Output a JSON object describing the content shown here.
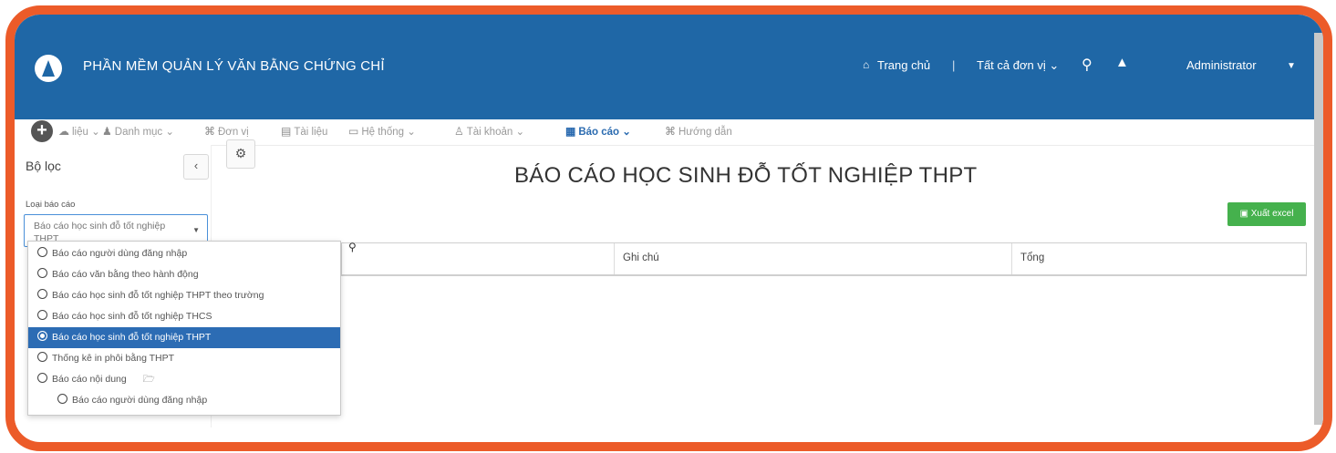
{
  "header": {
    "app_title": "PHẦN MỀM QUẢN LÝ VĂN BẰNG CHỨNG CHỈ",
    "home_label": "Trang chủ",
    "separator": "|",
    "unit_select": "Tất cả đơn vị ⌄",
    "user": "Administrator",
    "colors": {
      "bar": "#1f67a6",
      "frame": "#ec5b29"
    },
    "icons": [
      "home-icon",
      "search-icon",
      "bell-icon",
      "caret-down-icon"
    ]
  },
  "menu": {
    "items": [
      {
        "label": "liệu ⌄",
        "icon": "cloud-icon"
      },
      {
        "label": "Danh mục ⌄",
        "icon": "people-icon"
      },
      {
        "label": "Đơn vị",
        "icon": "org-icon"
      },
      {
        "label": "Tài liệu",
        "icon": "doc-icon"
      },
      {
        "label": "Hệ thống ⌄",
        "icon": "monitor-icon"
      },
      {
        "label": "Tài khoản ⌄",
        "icon": "user-icon"
      },
      {
        "label": "Báo cáo ⌄",
        "icon": "table-icon"
      },
      {
        "label": "Hướng dẫn",
        "icon": "help-icon"
      }
    ]
  },
  "filter": {
    "title": "Bộ lọc",
    "field_label": "Loại báo cáo",
    "selected_value": "Báo cáo học sinh đỗ tốt nghiệp THPT"
  },
  "dropdown": {
    "options": [
      "Báo cáo người dùng đăng nhập",
      "Báo cáo văn bằng theo hành động",
      "Báo cáo học sinh đỗ tốt nghiệp THPT theo trường",
      "Báo cáo học sinh đỗ tốt nghiệp THCS",
      "Báo cáo học sinh đỗ tốt nghiệp THPT",
      "Thống kê in phôi bằng THPT",
      "Báo cáo nội dung",
      "Báo cáo người dùng đăng nhập"
    ],
    "selected_index": 4
  },
  "report": {
    "title": "BÁO CÁO HỌC SINH ĐỖ TỐT NGHIỆP THPT",
    "export_label": "Xuất excel",
    "columns": [
      "Ghi chú",
      "Tổng"
    ]
  }
}
